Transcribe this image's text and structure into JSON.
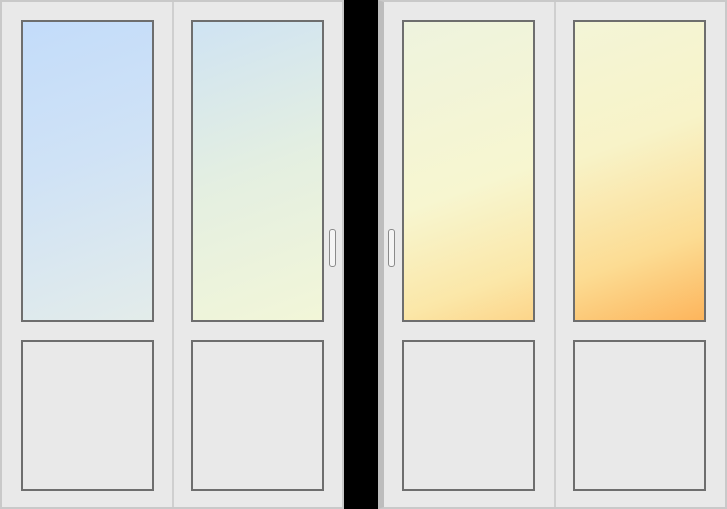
{
  "doors": [
    {
      "id": "left-door-unit",
      "leaves": [
        {
          "id": "leaf-1",
          "glass_tint": "blue"
        },
        {
          "id": "leaf-2",
          "glass_tint": "blue-yellow"
        }
      ]
    },
    {
      "id": "right-door-unit",
      "leaves": [
        {
          "id": "leaf-3",
          "glass_tint": "yellow"
        },
        {
          "id": "leaf-4",
          "glass_tint": "yellow-orange"
        }
      ]
    }
  ],
  "colors": {
    "frame": "#e9e9e9",
    "frame_border": "#6e6e6e",
    "background": "#000000",
    "glass_blue": "#c3dcfa",
    "glass_orange": "#fdb55c"
  }
}
